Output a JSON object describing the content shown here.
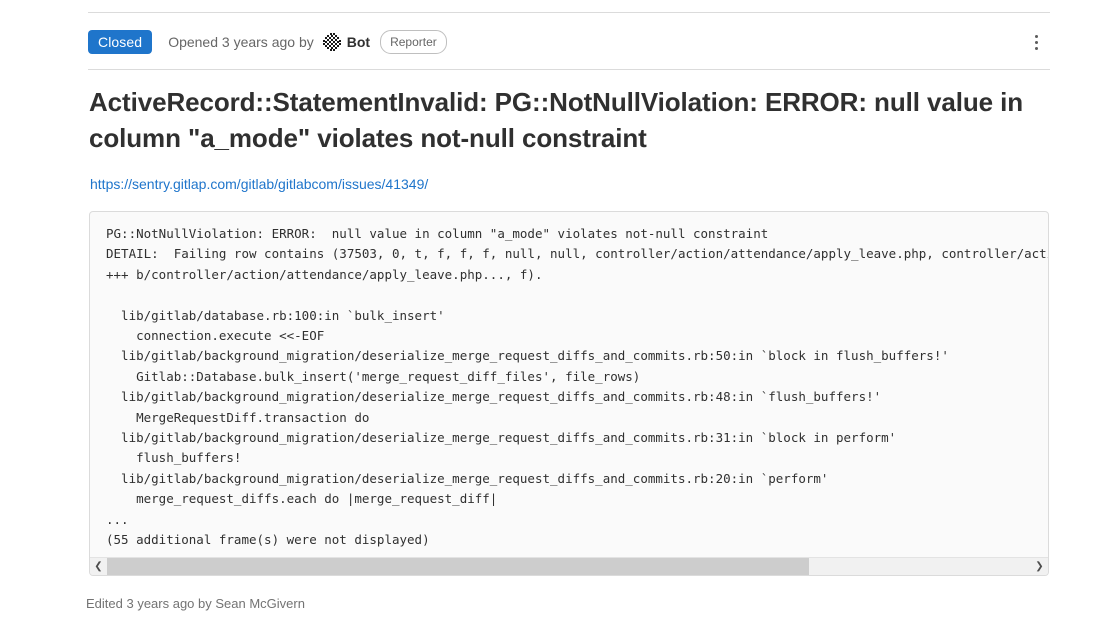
{
  "meta": {
    "state_label": "Closed",
    "state_color": "#1f75cb",
    "opened_text": "Opened 3 years ago by",
    "author": "Bot",
    "role": "Reporter",
    "avatar_icon": "identicon-avatar",
    "more_actions_icon": "kebab-menu-icon"
  },
  "title": "ActiveRecord::StatementInvalid: PG::NotNullViolation: ERROR: null value in column \"a_mode\" violates not-null constraint",
  "description": {
    "link_text": "https://sentry.gitlap.com/gitlab/gitlabcom/issues/41349/",
    "link_color": "#1f75cb"
  },
  "code_block": {
    "content": "PG::NotNullViolation: ERROR:  null value in column \"a_mode\" violates not-null constraint\nDETAIL:  Failing row contains (37503, 0, t, f, f, f, null, null, controller/action/attendance/apply_leave.php, controller/action/attend\n+++ b/controller/action/attendance/apply_leave.php..., f).\n\n  lib/gitlab/database.rb:100:in `bulk_insert'\n    connection.execute <<-EOF\n  lib/gitlab/background_migration/deserialize_merge_request_diffs_and_commits.rb:50:in `block in flush_buffers!'\n    Gitlab::Database.bulk_insert('merge_request_diff_files', file_rows)\n  lib/gitlab/background_migration/deserialize_merge_request_diffs_and_commits.rb:48:in `flush_buffers!'\n    MergeRequestDiff.transaction do\n  lib/gitlab/background_migration/deserialize_merge_request_diffs_and_commits.rb:31:in `block in perform'\n    flush_buffers!\n  lib/gitlab/background_migration/deserialize_merge_request_diffs_and_commits.rb:20:in `perform'\n    merge_request_diffs.each do |merge_request_diff|\n...\n(55 additional frame(s) were not displayed)",
    "scroll_left_icon": "chevron-left-icon",
    "scroll_right_icon": "chevron-right-icon",
    "scroll_thumb_percent": 76
  },
  "footer": {
    "edited_note": "Edited 3 years ago by Sean McGivern"
  }
}
